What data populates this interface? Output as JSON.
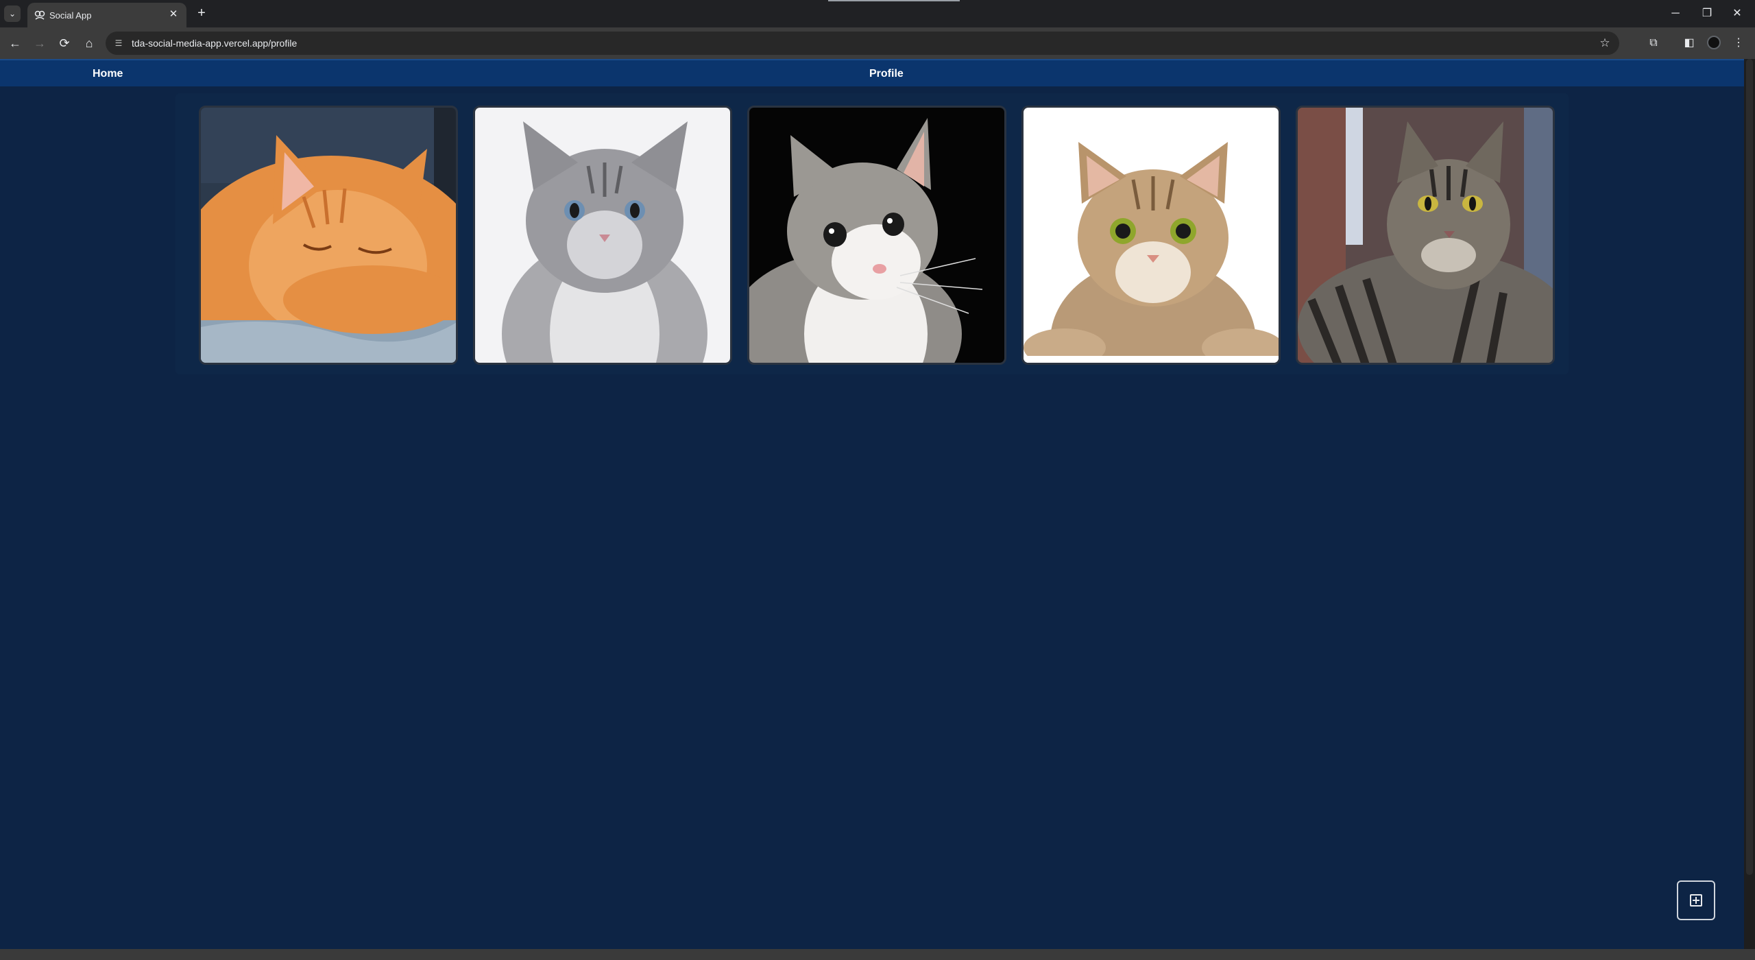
{
  "browser": {
    "tab_title": "Social App",
    "url": "tda-social-media-app.vercel.app/profile",
    "tab_search_glyph": "⌄",
    "new_tab_glyph": "+",
    "close_glyph": "✕",
    "minimize_glyph": "─",
    "restore_glyph": "❐",
    "window_close_glyph": "✕"
  },
  "navbar": {
    "home_label": "Home",
    "profile_label": "Profile"
  },
  "gallery": {
    "photos": [
      {
        "subject": "orange-cat-sleeping",
        "icon": "cat-photo"
      },
      {
        "subject": "gray-long-haired-cat",
        "icon": "cat-photo"
      },
      {
        "subject": "white-gray-cat-dark-background",
        "icon": "cat-photo"
      },
      {
        "subject": "tabby-cat-paws-white-background",
        "icon": "cat-photo"
      },
      {
        "subject": "striped-tabby-cat-outdoors",
        "icon": "cat-photo"
      }
    ]
  },
  "colors": {
    "page_background": "#0d2445",
    "navbar_background": "#0b356d",
    "chrome_dark": "#202124",
    "chrome_toolbar": "#3c3c3c"
  }
}
